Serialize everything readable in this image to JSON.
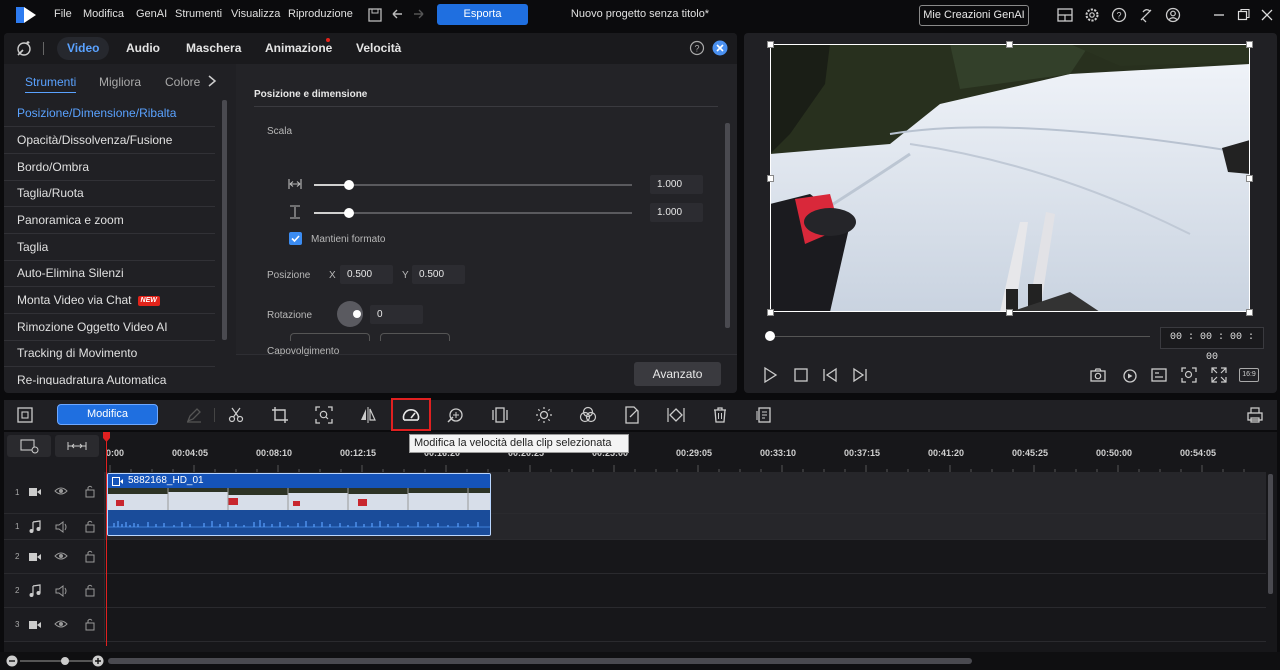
{
  "menu": [
    "File",
    "Modifica",
    "GenAI",
    "Strumenti",
    "Visualizza",
    "Riproduzione"
  ],
  "export_label": "Esporta",
  "project_title": "Nuovo progetto senza titolo*",
  "my_creations_label": "Mie Creazioni GenAI",
  "panel_tabs": [
    "Video",
    "Audio",
    "Maschera",
    "Animazione",
    "Velocità"
  ],
  "subtabs": [
    "Strumenti",
    "Migliora",
    "Colore"
  ],
  "tools_list": [
    {
      "label": "Posizione/Dimensione/Ribalta"
    },
    {
      "label": "Opacità/Dissolvenza/Fusione"
    },
    {
      "label": "Bordo/Ombra"
    },
    {
      "label": "Taglia/Ruota"
    },
    {
      "label": "Panoramica e zoom"
    },
    {
      "label": "Taglia"
    },
    {
      "label": "Auto-Elimina Silenzi"
    },
    {
      "label": "Monta Video via Chat",
      "badge": "NEW"
    },
    {
      "label": "Rimozione Oggetto Video AI"
    },
    {
      "label": "Tracking di Movimento"
    },
    {
      "label": "Re-inquadratura Automatica"
    }
  ],
  "settings": {
    "section_title": "Posizione e dimensione",
    "scale_label": "Scala",
    "scale_w": "1.000",
    "scale_h": "1.000",
    "scale_w_fraction": 0.11,
    "scale_h_fraction": 0.11,
    "keep_ratio_label": "Mantieni formato",
    "keep_ratio_checked": true,
    "position_label": "Posizione",
    "x_label": "X",
    "x_value": "0.500",
    "y_label": "Y",
    "y_value": "0.500",
    "rotation_label": "Rotazione",
    "rotation_value": "0",
    "flip_label": "Capovolgimento",
    "advanced_label": "Avanzato"
  },
  "preview": {
    "timecode": "00 : 00 : 00 : 00",
    "aspect": "16:9"
  },
  "toolbar": {
    "edit_label": "Modifica",
    "tooltip": "Modifica la velocità della clip selezionata"
  },
  "timeline": {
    "ruler": [
      "0:00",
      "00:04:05",
      "00:08:10",
      "00:12:15",
      "00:16:20",
      "00:20:25",
      "00:25:00",
      "00:29:05",
      "00:33:10",
      "00:37:15",
      "00:41:20",
      "00:45:25",
      "00:50:00",
      "00:54:05"
    ],
    "clip_name": "5882168_HD_01",
    "tracks": [
      {
        "num": "1",
        "type": "video"
      },
      {
        "num": "1",
        "type": "audio"
      },
      {
        "num": "2",
        "type": "video"
      },
      {
        "num": "2",
        "type": "audio"
      },
      {
        "num": "3",
        "type": "video"
      }
    ]
  }
}
